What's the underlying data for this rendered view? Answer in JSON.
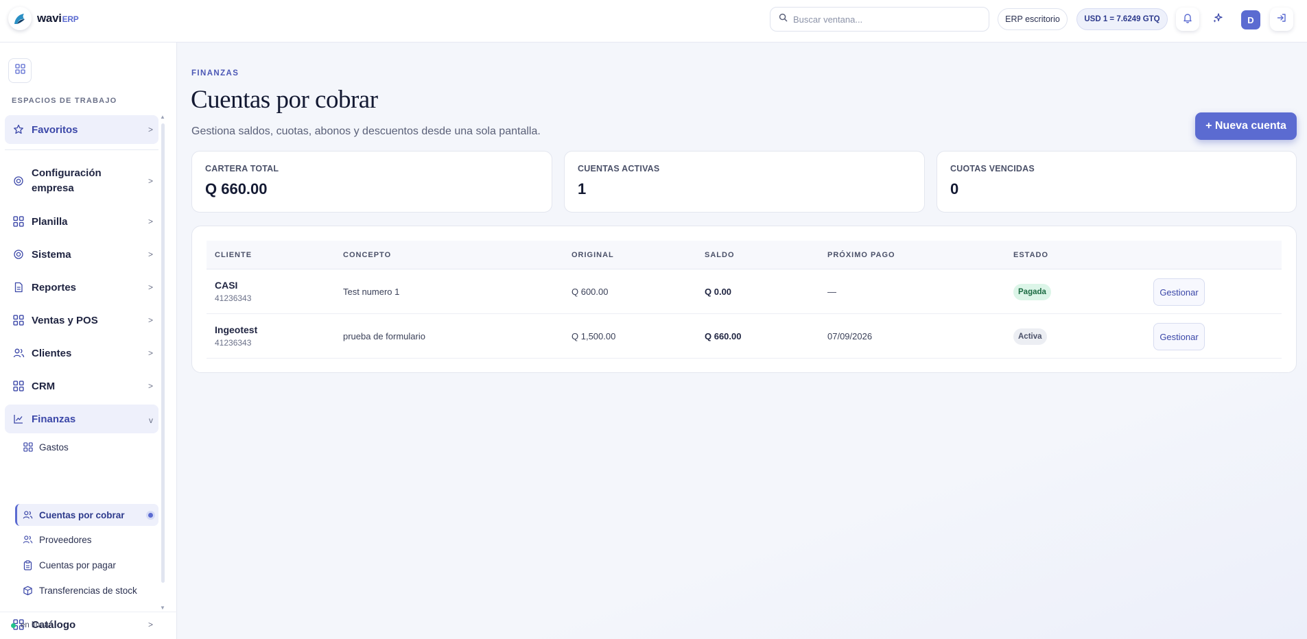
{
  "header": {
    "brand": "wavi",
    "brand_suffix": "ERP",
    "search_placeholder": "Buscar ventana...",
    "mode_label": "ERP escritorio",
    "exchange_rate": "USD 1 = 7.6249 GTQ",
    "user_initial": "D"
  },
  "sidebar": {
    "section_label": "ESPACIOS DE TRABAJO",
    "items": [
      {
        "label": "Favoritos",
        "icon": "star-icon",
        "chevron": ">"
      },
      {
        "label": "Configuración empresa",
        "icon": "target-icon",
        "chevron": ">"
      },
      {
        "label": "Planilla",
        "icon": "grid-icon",
        "chevron": ">"
      },
      {
        "label": "Sistema",
        "icon": "target-icon",
        "chevron": ">"
      },
      {
        "label": "Reportes",
        "icon": "document-icon",
        "chevron": ">"
      },
      {
        "label": "Ventas y POS",
        "icon": "grid-icon",
        "chevron": ">"
      },
      {
        "label": "Clientes",
        "icon": "users-icon",
        "chevron": ">"
      },
      {
        "label": "CRM",
        "icon": "grid-icon",
        "chevron": ">"
      },
      {
        "label": "Finanzas",
        "icon": "line-chart-icon",
        "chevron": "v"
      },
      {
        "label": "Catálogo",
        "icon": "grid-icon",
        "chevron": ">"
      }
    ],
    "finanzas_sub": [
      {
        "label": "Gastos",
        "icon": "grid-icon"
      },
      {
        "label": "Cuentas por cobrar",
        "icon": "users-icon"
      },
      {
        "label": "Proveedores",
        "icon": "users-icon"
      },
      {
        "label": "Cuentas por pagar",
        "icon": "clipboard-icon"
      },
      {
        "label": "Transferencias de stock",
        "icon": "box-icon"
      }
    ],
    "status": "en línea"
  },
  "main": {
    "breadcrumb": "FINANZAS",
    "title": "Cuentas por cobrar",
    "subtitle": "Gestiona saldos, cuotas, abonos y descuentos desde una sola pantalla.",
    "new_button": "+ Nueva cuenta",
    "stats": [
      {
        "label": "CARTERA TOTAL",
        "value": "Q 660.00"
      },
      {
        "label": "CUENTAS ACTIVAS",
        "value": "1"
      },
      {
        "label": "CUOTAS VENCIDAS",
        "value": "0"
      }
    ],
    "table": {
      "columns": [
        "CLIENTE",
        "CONCEPTO",
        "ORIGINAL",
        "SALDO",
        "PRÓXIMO PAGO",
        "ESTADO"
      ],
      "rows": [
        {
          "client": "CASI",
          "client_id": "41236343",
          "concept": "Test numero 1",
          "original": "Q 600.00",
          "balance": "Q 0.00",
          "next_payment": "—",
          "status": "Pagada",
          "action": "Gestionar"
        },
        {
          "client": "Ingeotest",
          "client_id": "41236343",
          "concept": "prueba de formulario",
          "original": "Q 1,500.00",
          "balance": "Q 660.00",
          "next_payment": "07/09/2026",
          "status": "Activa",
          "action": "Gestionar"
        }
      ]
    }
  },
  "colors": {
    "accent": "#5b6bd1",
    "paid_badge_bg": "#dcf5e8",
    "online_dot": "#22c38a"
  }
}
